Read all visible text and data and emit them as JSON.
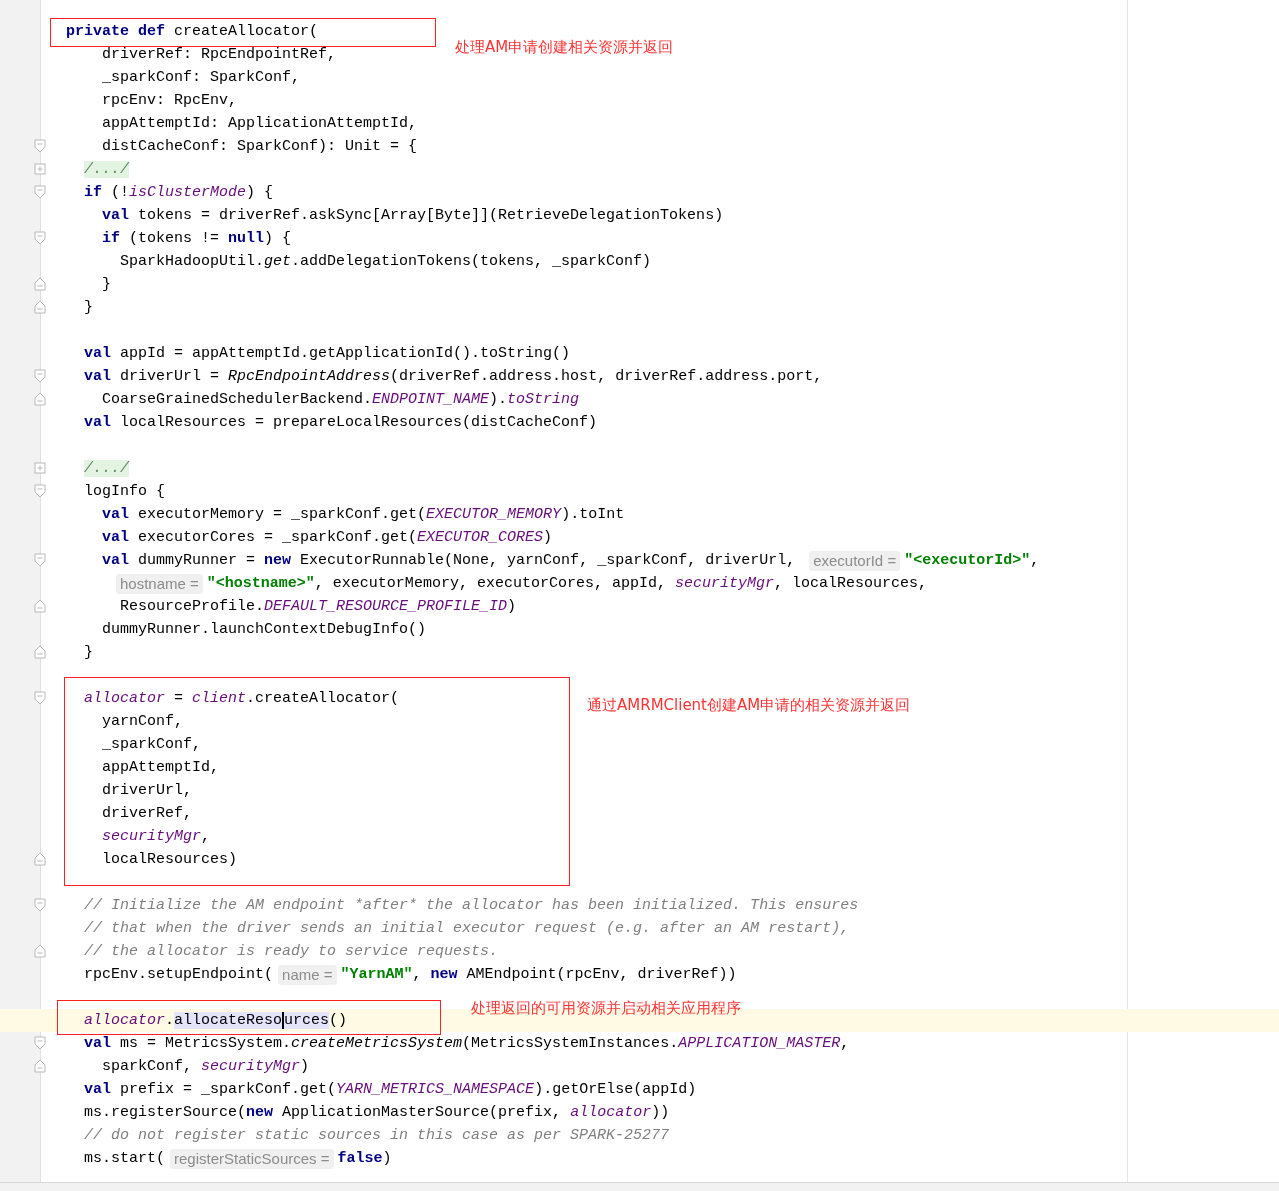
{
  "editor": {
    "lines": [
      {
        "current": false,
        "kind": "plain",
        "tokens": [
          {
            "text": "private def",
            "kind": "keyword"
          },
          {
            "text": " createAllocator(",
            "kind": "plain"
          }
        ]
      },
      {
        "current": false,
        "kind": "plain",
        "tokens": [
          {
            "text": "    driverRef: RpcEndpointRef,",
            "kind": "plain"
          }
        ]
      },
      {
        "current": false,
        "kind": "plain",
        "tokens": [
          {
            "text": "    _sparkConf: SparkConf,",
            "kind": "plain"
          }
        ]
      },
      {
        "current": false,
        "kind": "plain",
        "tokens": [
          {
            "text": "    rpcEnv: RpcEnv,",
            "kind": "plain"
          }
        ]
      },
      {
        "current": false,
        "kind": "plain",
        "tokens": [
          {
            "text": "    appAttemptId: ApplicationAttemptId,",
            "kind": "plain"
          }
        ]
      },
      {
        "current": false,
        "kind": "fold_start",
        "tokens": [
          {
            "text": "    distCacheConf: SparkConf): Unit = {",
            "kind": "plain"
          }
        ]
      },
      {
        "current": false,
        "kind": "collapsed",
        "tokens": [
          {
            "text": "  /.../",
            "kind": "folded"
          }
        ]
      },
      {
        "current": false,
        "kind": "fold_start",
        "tokens": [
          {
            "text": "  if",
            "kind": "keyword"
          },
          {
            "text": " (!",
            "kind": "plain"
          },
          {
            "text": "isClusterMode",
            "kind": "field"
          },
          {
            "text": ") {",
            "kind": "plain"
          }
        ]
      },
      {
        "current": false,
        "kind": "plain",
        "tokens": [
          {
            "text": "    val",
            "kind": "keyword"
          },
          {
            "text": " tokens = driverRef.askSync[Array[Byte]](RetrieveDelegationTokens)",
            "kind": "plain"
          }
        ]
      },
      {
        "current": false,
        "kind": "fold_start",
        "tokens": [
          {
            "text": "    if",
            "kind": "keyword"
          },
          {
            "text": " (tokens != ",
            "kind": "plain"
          },
          {
            "text": "null",
            "kind": "keyword"
          },
          {
            "text": ") {",
            "kind": "plain"
          }
        ]
      },
      {
        "current": false,
        "kind": "plain",
        "tokens": [
          {
            "text": "      SparkHadoopUtil.",
            "kind": "plain"
          },
          {
            "text": "get",
            "kind": "italic"
          },
          {
            "text": ".addDelegationTokens(tokens, _sparkConf)",
            "kind": "plain"
          }
        ]
      },
      {
        "current": false,
        "kind": "fold_end",
        "tokens": [
          {
            "text": "    }",
            "kind": "plain"
          }
        ]
      },
      {
        "current": false,
        "kind": "fold_end",
        "tokens": [
          {
            "text": "  }",
            "kind": "plain"
          }
        ]
      },
      {
        "current": false,
        "kind": "plain"
      },
      {
        "current": false,
        "kind": "plain",
        "tokens": [
          {
            "text": "  val",
            "kind": "keyword"
          },
          {
            "text": " appId = appAttemptId.getApplicationId().toString()",
            "kind": "plain"
          }
        ]
      },
      {
        "current": false,
        "kind": "fold_start",
        "tokens": [
          {
            "text": "  val",
            "kind": "keyword"
          },
          {
            "text": " driverUrl = ",
            "kind": "plain"
          },
          {
            "text": "RpcEndpointAddress",
            "kind": "italic"
          },
          {
            "text": "(driverRef.address.host, driverRef.address.port,",
            "kind": "plain"
          }
        ]
      },
      {
        "current": false,
        "kind": "fold_end",
        "tokens": [
          {
            "text": "    CoarseGrainedSchedulerBackend.",
            "kind": "plain"
          },
          {
            "text": "ENDPOINT_NAME",
            "kind": "field"
          },
          {
            "text": ").",
            "kind": "plain"
          },
          {
            "text": "toString",
            "kind": "field"
          }
        ]
      },
      {
        "current": false,
        "kind": "plain",
        "tokens": [
          {
            "text": "  val",
            "kind": "keyword"
          },
          {
            "text": " localResources = prepareLocalResources(distCacheConf)",
            "kind": "plain"
          }
        ]
      },
      {
        "current": false,
        "kind": "plain"
      },
      {
        "current": false,
        "kind": "collapsed",
        "tokens": [
          {
            "text": "  /.../",
            "kind": "folded"
          }
        ]
      },
      {
        "current": false,
        "kind": "fold_start",
        "tokens": [
          {
            "text": "  logInfo {",
            "kind": "plain"
          }
        ]
      },
      {
        "current": false,
        "kind": "plain",
        "tokens": [
          {
            "text": "    val",
            "kind": "keyword"
          },
          {
            "text": " executorMemory = _sparkConf.get(",
            "kind": "plain"
          },
          {
            "text": "EXECUTOR_MEMORY",
            "kind": "field"
          },
          {
            "text": ").toInt",
            "kind": "plain"
          }
        ]
      },
      {
        "current": false,
        "kind": "plain",
        "tokens": [
          {
            "text": "    val",
            "kind": "keyword"
          },
          {
            "text": " executorCores = _sparkConf.get(",
            "kind": "plain"
          },
          {
            "text": "EXECUTOR_CORES",
            "kind": "field"
          },
          {
            "text": ")",
            "kind": "plain"
          }
        ]
      },
      {
        "current": false,
        "kind": "fold_start",
        "tokens": [
          {
            "text": "    val",
            "kind": "keyword"
          },
          {
            "text": " dummyRunner = ",
            "kind": "plain"
          },
          {
            "text": "new",
            "kind": "keyword"
          },
          {
            "text": " ExecutorRunnable(None, yarnConf, _sparkConf, driverUrl, ",
            "kind": "plain"
          },
          {
            "text": "executorId =",
            "kind": "hint"
          },
          {
            "text": "\"<executorId>\"",
            "kind": "string"
          },
          {
            "text": ",",
            "kind": "plain"
          }
        ]
      },
      {
        "current": false,
        "kind": "plain",
        "tokens": [
          {
            "text": "     hostname =",
            "kind": "hint"
          },
          {
            "text": "\"<hostname>\"",
            "kind": "string"
          },
          {
            "text": ", executorMemory, executorCores, appId, ",
            "kind": "plain"
          },
          {
            "text": "securityMgr",
            "kind": "field"
          },
          {
            "text": ", localResources,",
            "kind": "plain"
          }
        ]
      },
      {
        "current": false,
        "kind": "fold_end",
        "tokens": [
          {
            "text": "      ResourceProfile.",
            "kind": "plain"
          },
          {
            "text": "DEFAULT_RESOURCE_PROFILE_ID",
            "kind": "field"
          },
          {
            "text": ")",
            "kind": "plain"
          }
        ]
      },
      {
        "current": false,
        "kind": "plain",
        "tokens": [
          {
            "text": "    dummyRunner.launchContextDebugInfo()",
            "kind": "plain"
          }
        ]
      },
      {
        "current": false,
        "kind": "fold_end",
        "tokens": [
          {
            "text": "  }",
            "kind": "plain"
          }
        ]
      },
      {
        "current": false,
        "kind": "plain"
      },
      {
        "current": false,
        "kind": "fold_start",
        "tokens": [
          {
            "text": "  allocator",
            "kind": "field"
          },
          {
            "text": " = ",
            "kind": "plain"
          },
          {
            "text": "client",
            "kind": "field"
          },
          {
            "text": ".createAllocator(",
            "kind": "plain"
          }
        ]
      },
      {
        "current": false,
        "kind": "plain",
        "tokens": [
          {
            "text": "    yarnConf,",
            "kind": "plain"
          }
        ]
      },
      {
        "current": false,
        "kind": "plain",
        "tokens": [
          {
            "text": "    _sparkConf,",
            "kind": "plain"
          }
        ]
      },
      {
        "current": false,
        "kind": "plain",
        "tokens": [
          {
            "text": "    appAttemptId,",
            "kind": "plain"
          }
        ]
      },
      {
        "current": false,
        "kind": "plain",
        "tokens": [
          {
            "text": "    driverUrl,",
            "kind": "plain"
          }
        ]
      },
      {
        "current": false,
        "kind": "plain",
        "tokens": [
          {
            "text": "    driverRef,",
            "kind": "plain"
          }
        ]
      },
      {
        "current": false,
        "kind": "plain",
        "tokens": [
          {
            "text": "    securityMgr",
            "kind": "field"
          },
          {
            "text": ",",
            "kind": "plain"
          }
        ]
      },
      {
        "current": false,
        "kind": "fold_end",
        "tokens": [
          {
            "text": "    localResources)",
            "kind": "plain"
          }
        ]
      },
      {
        "current": false,
        "kind": "plain"
      },
      {
        "current": false,
        "kind": "fold_start",
        "tokens": [
          {
            "text": "  // Initialize the AM endpoint *after* the allocator has been initialized. This ensures",
            "kind": "comment"
          }
        ]
      },
      {
        "current": false,
        "kind": "plain",
        "tokens": [
          {
            "text": "  // that when the driver sends an initial executor request (e.g. after an AM restart),",
            "kind": "comment"
          }
        ]
      },
      {
        "current": false,
        "kind": "fold_end",
        "tokens": [
          {
            "text": "  // the allocator is ready to service requests.",
            "kind": "comment"
          }
        ]
      },
      {
        "current": false,
        "kind": "plain",
        "tokens": [
          {
            "text": "  rpcEnv.setupEndpoint(",
            "kind": "plain"
          },
          {
            "text": "name =",
            "kind": "hint"
          },
          {
            "text": "\"YarnAM\"",
            "kind": "string"
          },
          {
            "text": ", ",
            "kind": "plain"
          },
          {
            "text": "new",
            "kind": "keyword"
          },
          {
            "text": " AMEndpoint(rpcEnv, driverRef))",
            "kind": "plain"
          }
        ]
      },
      {
        "current": false,
        "kind": "plain"
      },
      {
        "current": true,
        "kind": "plain",
        "tokens": [
          {
            "text": "  allocator",
            "kind": "field"
          },
          {
            "text": ".",
            "kind": "plain"
          },
          {
            "text": "allocateReso",
            "kind": "match",
            "caret": true
          },
          {
            "text": "urces",
            "kind": "match",
            "caret": false
          },
          {
            "text": "()",
            "kind": "plain"
          }
        ]
      },
      {
        "current": false,
        "kind": "fold_start",
        "tokens": [
          {
            "text": "  val",
            "kind": "keyword"
          },
          {
            "text": " ms = MetricsSystem.",
            "kind": "plain"
          },
          {
            "text": "createMetricsSystem",
            "kind": "italic"
          },
          {
            "text": "(MetricsSystemInstances.",
            "kind": "plain"
          },
          {
            "text": "APPLICATION_MASTER",
            "kind": "field"
          },
          {
            "text": ",",
            "kind": "plain"
          }
        ]
      },
      {
        "current": false,
        "kind": "fold_end",
        "tokens": [
          {
            "text": "    sparkConf, ",
            "kind": "plain"
          },
          {
            "text": "securityMgr",
            "kind": "field"
          },
          {
            "text": ")",
            "kind": "plain"
          }
        ]
      },
      {
        "current": false,
        "kind": "plain",
        "tokens": [
          {
            "text": "  val",
            "kind": "keyword"
          },
          {
            "text": " prefix = _sparkConf.get(",
            "kind": "plain"
          },
          {
            "text": "YARN_METRICS_NAMESPACE",
            "kind": "field"
          },
          {
            "text": ").getOrElse(appId)",
            "kind": "plain"
          }
        ]
      },
      {
        "current": false,
        "kind": "plain",
        "tokens": [
          {
            "text": "  ms.registerSource(",
            "kind": "plain"
          },
          {
            "text": "new",
            "kind": "keyword"
          },
          {
            "text": " ApplicationMasterSource(prefix, ",
            "kind": "plain"
          },
          {
            "text": "allocator",
            "kind": "field"
          },
          {
            "text": "))",
            "kind": "plain"
          }
        ]
      },
      {
        "current": false,
        "kind": "plain",
        "tokens": [
          {
            "text": "  // do not register static sources in this case as per SPARK-25277",
            "kind": "comment"
          }
        ]
      },
      {
        "current": false,
        "kind": "plain",
        "tokens": [
          {
            "text": "  ms.start(",
            "kind": "plain"
          },
          {
            "text": "registerStaticSources =",
            "kind": "hint"
          },
          {
            "text": "false",
            "kind": "keyword"
          },
          {
            "text": ")",
            "kind": "plain"
          }
        ]
      }
    ]
  },
  "annotations": [
    {
      "text": "处理AM申请创建相关资源并返回"
    },
    {
      "text": "通过AMRMClient创建AM申请的相关资源并返回"
    },
    {
      "text": "处理返回的可用资源并启动相关应用程序"
    }
  ]
}
